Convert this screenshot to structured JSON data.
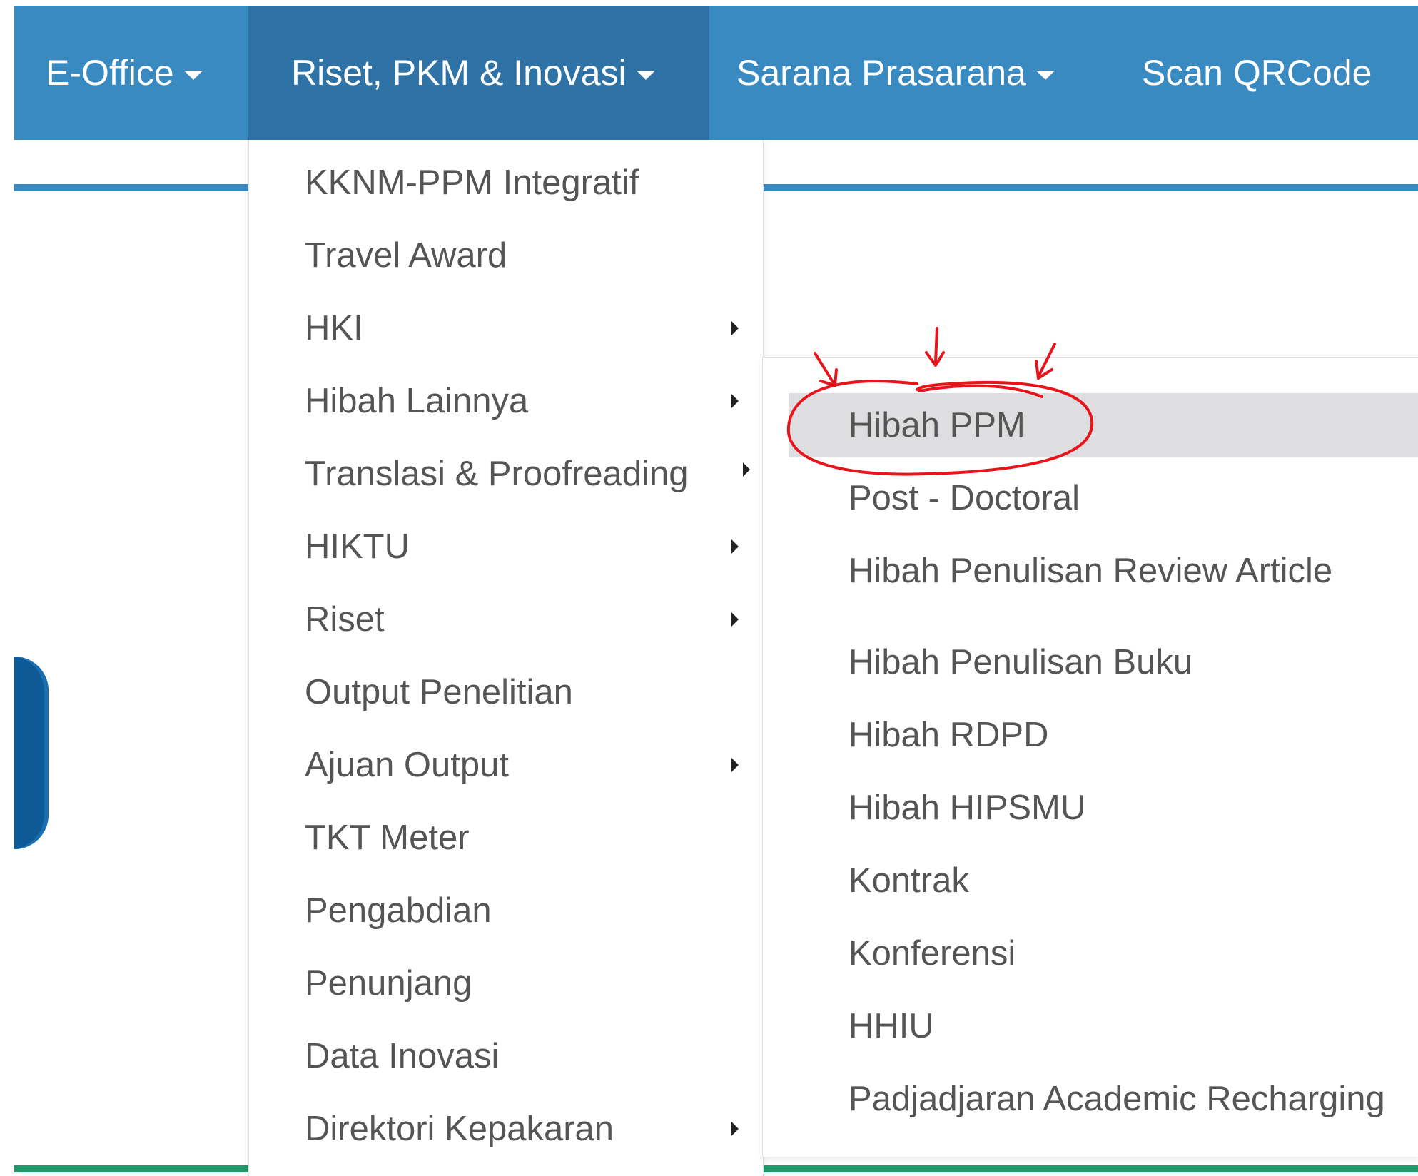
{
  "navbar": {
    "items": [
      {
        "label": "E-Office",
        "has_caret": true
      },
      {
        "label": "Riset, PKM & Inovasi",
        "has_caret": true,
        "active": true
      },
      {
        "label": "Sarana Prasarana",
        "has_caret": true
      },
      {
        "label": "Scan QRCode",
        "has_caret": false
      }
    ]
  },
  "main_menu": {
    "items": [
      {
        "label": "KKNM-PPM Integratif",
        "submenu": false
      },
      {
        "label": "Travel Award",
        "submenu": false
      },
      {
        "label": "HKI",
        "submenu": true
      },
      {
        "label": "Hibah Lainnya",
        "submenu": true
      },
      {
        "label": "Translasi & Proofreading",
        "submenu": true
      },
      {
        "label": "HIKTU",
        "submenu": true
      },
      {
        "label": "Riset",
        "submenu": true
      },
      {
        "label": "Output Penelitian",
        "submenu": false
      },
      {
        "label": "Ajuan Output",
        "submenu": true
      },
      {
        "label": "TKT Meter",
        "submenu": false
      },
      {
        "label": "Pengabdian",
        "submenu": false
      },
      {
        "label": "Penunjang",
        "submenu": false
      },
      {
        "label": "Data Inovasi",
        "submenu": false
      },
      {
        "label": "Direktori Kepakaran",
        "submenu": true
      }
    ]
  },
  "sub_menu": {
    "parent": "Hibah Lainnya",
    "items": [
      {
        "label": "Hibah PPM",
        "highlighted": true
      },
      {
        "label": "Post - Doctoral"
      },
      {
        "label": "Hibah Penulisan Review Article"
      },
      {
        "label": "Hibah Penulisan Buku"
      },
      {
        "label": "Hibah RDPD"
      },
      {
        "label": "Hibah HIPSMU"
      },
      {
        "label": "Kontrak"
      },
      {
        "label": "Konferensi"
      },
      {
        "label": "HHIU"
      },
      {
        "label": "Padjadjaran Academic Recharging"
      }
    ]
  },
  "colors": {
    "navbar": "#3a8ac2",
    "navbar_active": "#2e72a6",
    "annotation": "#e8141c",
    "highlight": "#dedee0",
    "menu_text": "#555555"
  },
  "annotation": {
    "shape": "red-circle-with-arrows",
    "target": "Hibah PPM"
  }
}
